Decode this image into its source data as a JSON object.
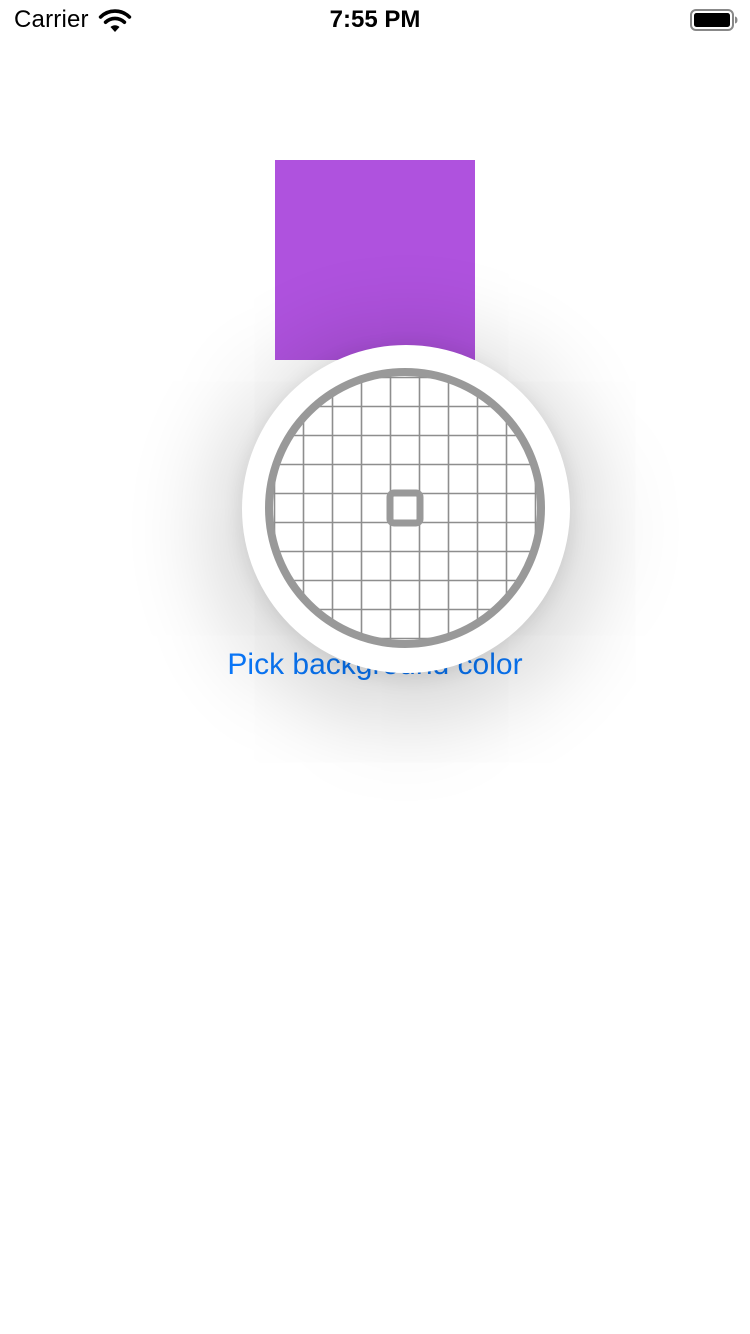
{
  "status_bar": {
    "carrier": "Carrier",
    "time": "7:55 PM",
    "wifi_icon": "wifi-icon",
    "battery_icon": "battery-icon"
  },
  "swatch": {
    "color": "#af52de"
  },
  "pick_button": {
    "label": "Pick background color",
    "color": "#0a7aff"
  },
  "loupe": {
    "icon": "eyedropper-loupe-icon",
    "ring_color": "#999999",
    "grid_color": "#8e8e8e"
  }
}
